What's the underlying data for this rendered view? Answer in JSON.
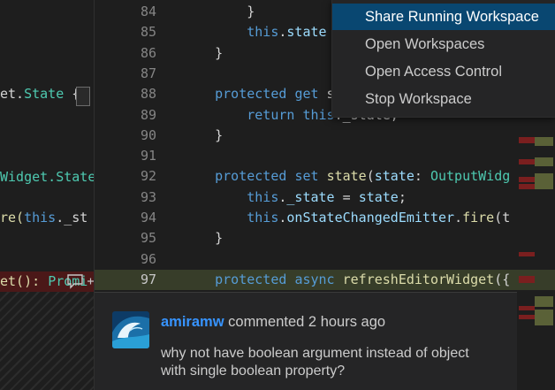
{
  "left_pane": {
    "lines": [
      {
        "text_a": "et.",
        "text_b": "State",
        "text_c": " {"
      },
      {
        "text_a": "Widget.",
        "text_b": "State"
      },
      {
        "text_a": "re(",
        "text_b": "this",
        "text_c": "._st"
      },
      {
        "text_a": "et(): ",
        "text_b": "Promi"
      }
    ]
  },
  "editor": {
    "lines": [
      {
        "num": "84",
        "parts": [
          [
            "",
            "        }"
          ]
        ]
      },
      {
        "num": "85",
        "parts": [
          [
            "",
            "        "
          ],
          [
            "kw",
            "this"
          ],
          [
            "",
            "."
          ],
          [
            "var",
            "state"
          ]
        ]
      },
      {
        "num": "86",
        "parts": [
          [
            "",
            "    }"
          ]
        ]
      },
      {
        "num": "87",
        "parts": []
      },
      {
        "num": "88",
        "parts": [
          [
            "",
            "    "
          ],
          [
            "kw",
            "protected"
          ],
          [
            "",
            " "
          ],
          [
            "kw",
            "get"
          ],
          [
            "",
            " s"
          ]
        ]
      },
      {
        "num": "89",
        "parts": [
          [
            "",
            "        "
          ],
          [
            "kw",
            "return"
          ],
          [
            "",
            " "
          ],
          [
            "kw",
            "this"
          ],
          [
            "",
            "._state;"
          ]
        ]
      },
      {
        "num": "90",
        "parts": [
          [
            "",
            "    }"
          ]
        ]
      },
      {
        "num": "91",
        "parts": []
      },
      {
        "num": "92",
        "parts": [
          [
            "",
            "    "
          ],
          [
            "kw",
            "protected"
          ],
          [
            "",
            " "
          ],
          [
            "kw",
            "set"
          ],
          [
            "",
            " "
          ],
          [
            "fn",
            "state"
          ],
          [
            "",
            "("
          ],
          [
            "var",
            "state"
          ],
          [
            "",
            ": "
          ],
          [
            "cls",
            "OutputWidg"
          ]
        ]
      },
      {
        "num": "93",
        "parts": [
          [
            "",
            "        "
          ],
          [
            "kw",
            "this"
          ],
          [
            "",
            "."
          ],
          [
            "var",
            "_state"
          ],
          [
            "",
            " = "
          ],
          [
            "var",
            "state"
          ],
          [
            "",
            ";"
          ]
        ]
      },
      {
        "num": "94",
        "parts": [
          [
            "",
            "        "
          ],
          [
            "kw",
            "this"
          ],
          [
            "",
            "."
          ],
          [
            "var",
            "onStateChangedEmitter"
          ],
          [
            "",
            "."
          ],
          [
            "fn",
            "fire"
          ],
          [
            "",
            "(t"
          ]
        ]
      },
      {
        "num": "95",
        "parts": [
          [
            "",
            "    }"
          ]
        ]
      },
      {
        "num": "96",
        "parts": []
      },
      {
        "num": "97",
        "added": true,
        "parts": [
          [
            "",
            "    "
          ],
          [
            "kw",
            "protected"
          ],
          [
            "",
            " "
          ],
          [
            "kw",
            "async"
          ],
          [
            "",
            " "
          ],
          [
            "fn",
            "refreshEditorWidget"
          ],
          [
            "",
            "({"
          ]
        ]
      }
    ]
  },
  "comment": {
    "author": "amiramw",
    "action": "commented 2 hours ago",
    "body": "why not have boolean argument instead of object with single boolean property?"
  },
  "context_menu": {
    "items": [
      {
        "label": "Share Running Workspace",
        "selected": true
      },
      {
        "label": "Open Workspaces"
      },
      {
        "label": "Open Access Control"
      },
      {
        "label": "Stop Workspace"
      }
    ]
  },
  "colors": {
    "background": "#1e1e1e",
    "menu_selected": "#094771",
    "added_line": "#373d29",
    "deleted_line": "#4b1818",
    "author_link": "#3794ff"
  }
}
